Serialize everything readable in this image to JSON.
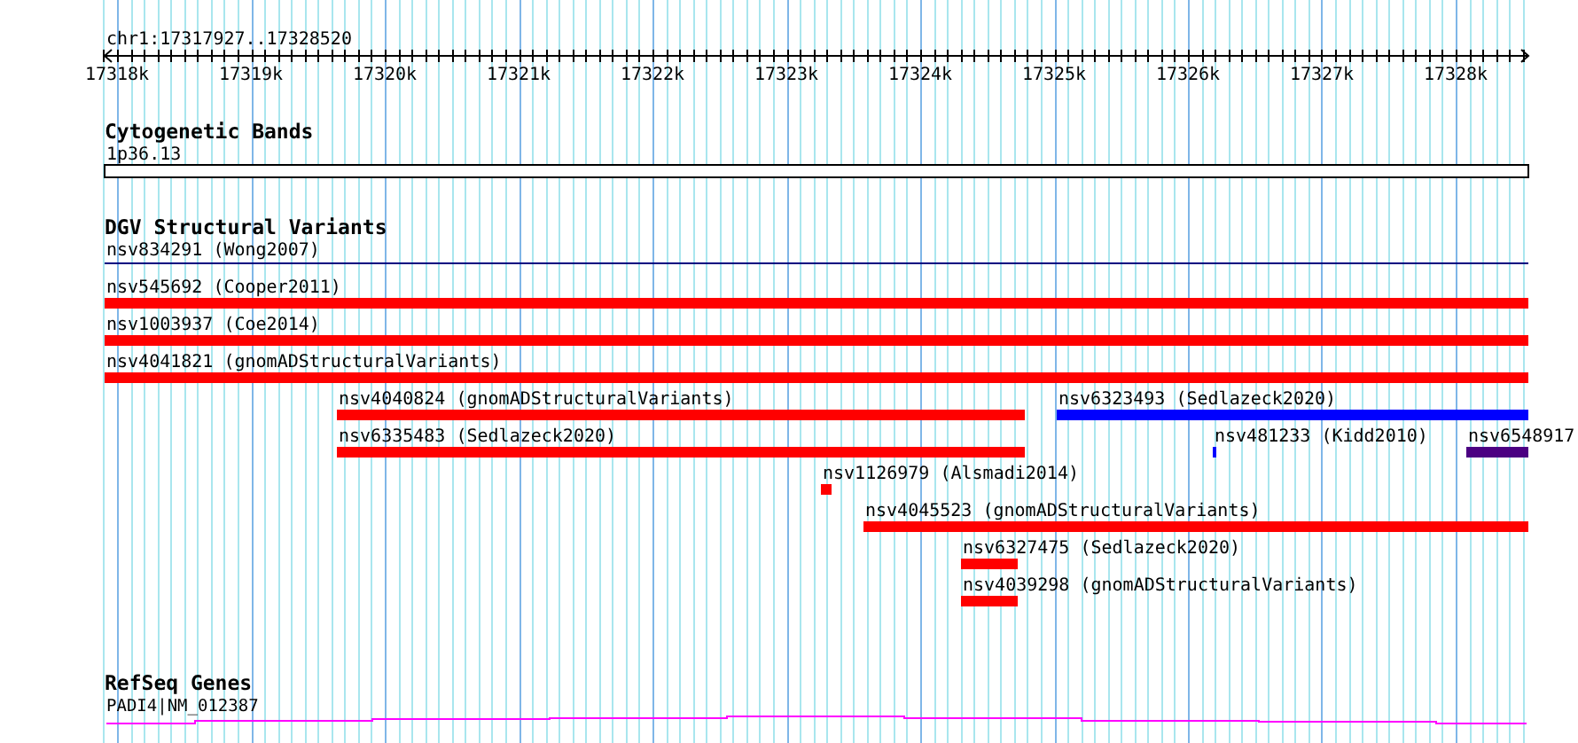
{
  "ruler": {
    "location": "chr1:17317927..17328520",
    "ticks": [
      "17318k",
      "17319k",
      "17320k",
      "17321k",
      "17322k",
      "17323k",
      "17324k",
      "17325k",
      "17326k",
      "17327k",
      "17328k"
    ]
  },
  "tracks": [
    {
      "kind": "cytoband",
      "title": "Cytogenetic Bands",
      "features": [
        {
          "label": "1p36.13",
          "color": "#000000"
        }
      ]
    },
    {
      "kind": "variants",
      "title": "DGV Structural Variants",
      "features": [
        {
          "label": "nsv834291 (Wong2007)",
          "color": "#000080"
        },
        {
          "label": "nsv545692 (Cooper2011)",
          "color": "#ff0000"
        },
        {
          "label": "nsv1003937 (Coe2014)",
          "color": "#ff0000"
        },
        {
          "label": "nsv4041821 (gnomADStructuralVariants)",
          "color": "#ff0000"
        },
        {
          "label": "nsv4040824 (gnomADStructuralVariants)",
          "color": "#ff0000"
        },
        {
          "label": "nsv6323493 (Sedlazeck2020)",
          "color": "#0000ff"
        },
        {
          "label": "nsv6335483 (Sedlazeck2020)",
          "color": "#ff0000"
        },
        {
          "label": "nsv481233 (Kidd2010)",
          "color": "#0000ff"
        },
        {
          "label": "nsv6548917",
          "color": "#4b0082"
        },
        {
          "label": "nsv1126979 (Alsmadi2014)",
          "color": "#ff0000"
        },
        {
          "label": "nsv4045523 (gnomADStructuralVariants)",
          "color": "#ff0000"
        },
        {
          "label": "nsv6327475 (Sedlazeck2020)",
          "color": "#ff0000"
        },
        {
          "label": "nsv4039298 (gnomADStructuralVariants)",
          "color": "#ff0000"
        }
      ]
    },
    {
      "kind": "genes",
      "title": "RefSeq Genes",
      "features": [
        {
          "label": "PADI4|NM_012387",
          "color": "#ff00ff"
        }
      ]
    }
  ]
}
